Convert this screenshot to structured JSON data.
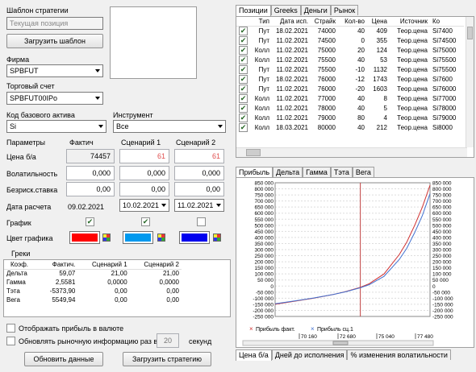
{
  "strategy_template": {
    "label": "Шаблон стратегии",
    "placeholder": "Текущая позиция",
    "load_button": "Загрузить шаблон"
  },
  "firm": {
    "label": "Фирма",
    "value": "SPBFUT"
  },
  "account": {
    "label": "Торговый счет",
    "value": "SPBFUT00IPo"
  },
  "base_code": {
    "label": "Код базового актива",
    "value": "Si"
  },
  "instrument": {
    "label": "Инструмент",
    "value": "Все"
  },
  "params": {
    "header": "Параметры",
    "col_fact": "Фактич",
    "col_s1": "Сценарий 1",
    "col_s2": "Сценарий 2",
    "rows": {
      "price": {
        "label": "Цена б/а",
        "fact": "74457",
        "s1": "61",
        "s2": "61"
      },
      "vol": {
        "label": "Волатильность",
        "fact": "0,000",
        "s1": "0,000",
        "s2": "0,000"
      },
      "rate": {
        "label": "Безриск.ставка",
        "fact": "0,00",
        "s1": "0,00",
        "s2": "0,00"
      },
      "date": {
        "label": "Дата расчета",
        "fact": "09.02.2021",
        "s1": "10.02.2021",
        "s2": "11.02.2021"
      },
      "chart": {
        "label": "График"
      },
      "color": {
        "label": "Цвет графика",
        "fact": "#ff0000",
        "s1": "#0099ee",
        "s2": "#0000ee"
      }
    }
  },
  "greeks": {
    "title": "Греки",
    "headers": [
      "Коэф.",
      "Фактич.",
      "Сценарий 1",
      "Сценарий 2"
    ],
    "rows": [
      [
        "Дельта",
        "59,07",
        "21,00",
        "21,00"
      ],
      [
        "Гамма",
        "2,5581",
        "0,0000",
        "0,0000"
      ],
      [
        "Тэта",
        "-5373,90",
        "0,00",
        "0,00"
      ],
      [
        "Вега",
        "5549,94",
        "0,00",
        "0,00"
      ]
    ]
  },
  "options": {
    "show_currency": "Отображать прибыль в валюте",
    "refresh_label": "Обновлять рыночную информацию раз в",
    "refresh_value": "20",
    "refresh_unit": "секунд"
  },
  "buttons": {
    "update": "Обновить данные",
    "load_strategy": "Загрузить стратегию"
  },
  "top_tabs": [
    "Позиции",
    "Greeks",
    "Деньги",
    "Рынок"
  ],
  "positions": {
    "headers": [
      "Тип",
      "Дата исп.",
      "Страйк",
      "Кол-во",
      "Цена",
      "Источник",
      "Ко"
    ],
    "rows": [
      [
        "Пут",
        "18.02.2021",
        "74000",
        "40",
        "409",
        "Теор.цена",
        "Si7400"
      ],
      [
        "Пут",
        "11.02.2021",
        "74500",
        "0",
        "355",
        "Теор.цена",
        "Si74500"
      ],
      [
        "Колл",
        "11.02.2021",
        "75000",
        "20",
        "124",
        "Теор.цена",
        "Si75000"
      ],
      [
        "Колл",
        "11.02.2021",
        "75500",
        "40",
        "53",
        "Теор.цена",
        "Si75500"
      ],
      [
        "Пут",
        "11.02.2021",
        "75500",
        "-10",
        "1132",
        "Теор.цена",
        "Si75500"
      ],
      [
        "Пут",
        "18.02.2021",
        "76000",
        "-12",
        "1743",
        "Теор.цена",
        "Si7600"
      ],
      [
        "Пут",
        "11.02.2021",
        "76000",
        "-20",
        "1603",
        "Теор.цена",
        "Si76000"
      ],
      [
        "Колл",
        "11.02.2021",
        "77000",
        "40",
        "8",
        "Теор.цена",
        "Si77000"
      ],
      [
        "Колл",
        "11.02.2021",
        "78000",
        "40",
        "5",
        "Теор.цена",
        "Si78000"
      ],
      [
        "Колл",
        "11.02.2021",
        "79000",
        "80",
        "4",
        "Теор.цена",
        "Si79000"
      ],
      [
        "Колл",
        "18.03.2021",
        "80000",
        "40",
        "212",
        "Теор.цена",
        "Si8000"
      ]
    ]
  },
  "chart_tabs": [
    "Прибыль",
    "Дельта",
    "Гамма",
    "Тэта",
    "Вега"
  ],
  "bottom_tabs": [
    "Цена б/а",
    "Дней до исполнения",
    "% изменения волатильности"
  ],
  "chart_data": {
    "type": "line",
    "yticks": [
      "850 000",
      "800 000",
      "750 000",
      "700 000",
      "650 000",
      "600 000",
      "550 000",
      "500 000",
      "450 000",
      "400 000",
      "350 000",
      "300 000",
      "250 000",
      "200 000",
      "150 000",
      "100 000",
      "50 000",
      "0",
      "-50 000",
      "-100 000",
      "-150 000",
      "-200 000",
      "-250 000"
    ],
    "xticks": [
      "70 160",
      "72 680",
      "75 040",
      "77 480"
    ],
    "ylim": [
      -250000,
      850000
    ],
    "xlim": [
      68900,
      79000
    ],
    "vline": 74457,
    "series": [
      {
        "name": "Прибыль факт.",
        "color": "#d03030",
        "x": [
          68900,
          70160,
          71400,
          72680,
          73500,
          74457,
          75040,
          76000,
          77000,
          77480,
          78000,
          78500,
          79000
        ],
        "y": [
          -150000,
          -125000,
          -100000,
          -70000,
          -45000,
          -10000,
          20000,
          100000,
          260000,
          360000,
          500000,
          650000,
          830000
        ]
      },
      {
        "name": "Прибыль сц.1",
        "color": "#4070d0",
        "x": [
          68900,
          70160,
          71400,
          72680,
          73500,
          74457,
          75040,
          76000,
          77000,
          77480,
          78000,
          78500,
          79000
        ],
        "y": [
          -145000,
          -122000,
          -98000,
          -70000,
          -47000,
          -14000,
          12000,
          80000,
          220000,
          310000,
          440000,
          580000,
          760000
        ]
      }
    ]
  }
}
